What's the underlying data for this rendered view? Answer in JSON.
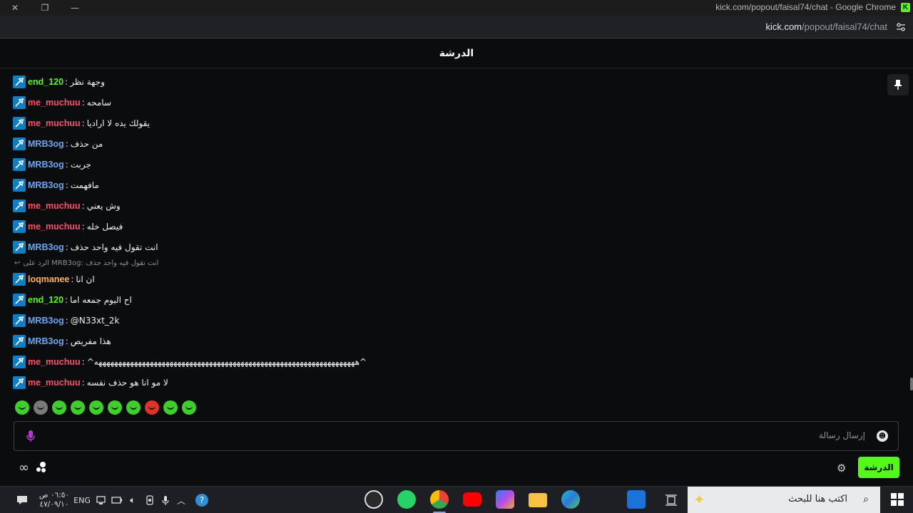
{
  "window": {
    "title": "kick.com/popout/faisal74/chat - Google Chrome",
    "url_domain": "kick.com",
    "url_path": "/popout/faisal74/chat"
  },
  "chat": {
    "header_title": "الدرشة",
    "messages": [
      {
        "user": "end_120",
        "color": "#53fc18",
        "text": "وجهة نظر"
      },
      {
        "user": "me_muchuu",
        "color": "#ff4f6b",
        "text": "سامحه"
      },
      {
        "user": "me_muchuu",
        "color": "#ff4f6b",
        "text": "يقولك يده لا اراديا"
      },
      {
        "user": "MRB3og",
        "color": "#6aa6f0",
        "text": "من حذف"
      },
      {
        "user": "MRB3og",
        "color": "#6aa6f0",
        "text": "جربت"
      },
      {
        "user": "MRB3og",
        "color": "#6aa6f0",
        "text": "مافهمت"
      },
      {
        "user": "me_muchuu",
        "color": "#ff4f6b",
        "text": "وش يعني"
      },
      {
        "user": "me_muchuu",
        "color": "#ff4f6b",
        "text": "فيصل خله"
      },
      {
        "user": "MRB3og",
        "color": "#6aa6f0",
        "text": "انت تقول فيه واحد حذف"
      },
      {
        "reply_to": "الرد على MRB3og: انت تقول فيه واحد حذف",
        "user": "loqmanee",
        "color": "#ffb347",
        "text": "ان انا"
      },
      {
        "user": "end_120",
        "color": "#53fc18",
        "text": "اح اليوم جمعه اما"
      },
      {
        "user": "MRB3og",
        "color": "#6aa6f0",
        "text": "@N33xt_2k"
      },
      {
        "user": "MRB3og",
        "color": "#6aa6f0",
        "text": "هذا مفريص"
      },
      {
        "user": "me_muchuu",
        "color": "#ff4f6b",
        "text": "^ههههههههههههههههههههههههههههههههههههههههههههههههههههههههههههههههههه^"
      },
      {
        "user": "me_muchuu",
        "color": "#ff4f6b",
        "text": "لا مو انا هو حذف نفسه"
      }
    ],
    "emotes": [
      {
        "name": "emote-1",
        "color": "#3ecf2a"
      },
      {
        "name": "emote-2",
        "color": "#7a7a7a"
      },
      {
        "name": "emote-3",
        "color": "#3ecf2a"
      },
      {
        "name": "emote-4",
        "color": "#3ecf2a"
      },
      {
        "name": "emote-5",
        "color": "#3ecf2a"
      },
      {
        "name": "emote-6",
        "color": "#3ecf2a"
      },
      {
        "name": "emote-7",
        "color": "#3ecf2a"
      },
      {
        "name": "emote-8",
        "color": "#e0322b"
      },
      {
        "name": "emote-9",
        "color": "#3ecf2a"
      },
      {
        "name": "emote-10",
        "color": "#3ecf2a"
      }
    ],
    "input_placeholder": "إرسال رسالة",
    "chat_button_label": "الدرشة"
  },
  "taskbar": {
    "time": "٠٦:٥٠ ص",
    "date": "٤٧/٠٩/١٠",
    "language": "ENG",
    "search_placeholder": "اكتب هنا للبحث",
    "pinned_apps": [
      "obs-icon",
      "whatsapp-icon",
      "chrome-icon",
      "youtube-icon",
      "m365-icon",
      "file-explorer-icon",
      "edge-icon",
      "outlook-icon",
      "task-view-icon"
    ]
  }
}
